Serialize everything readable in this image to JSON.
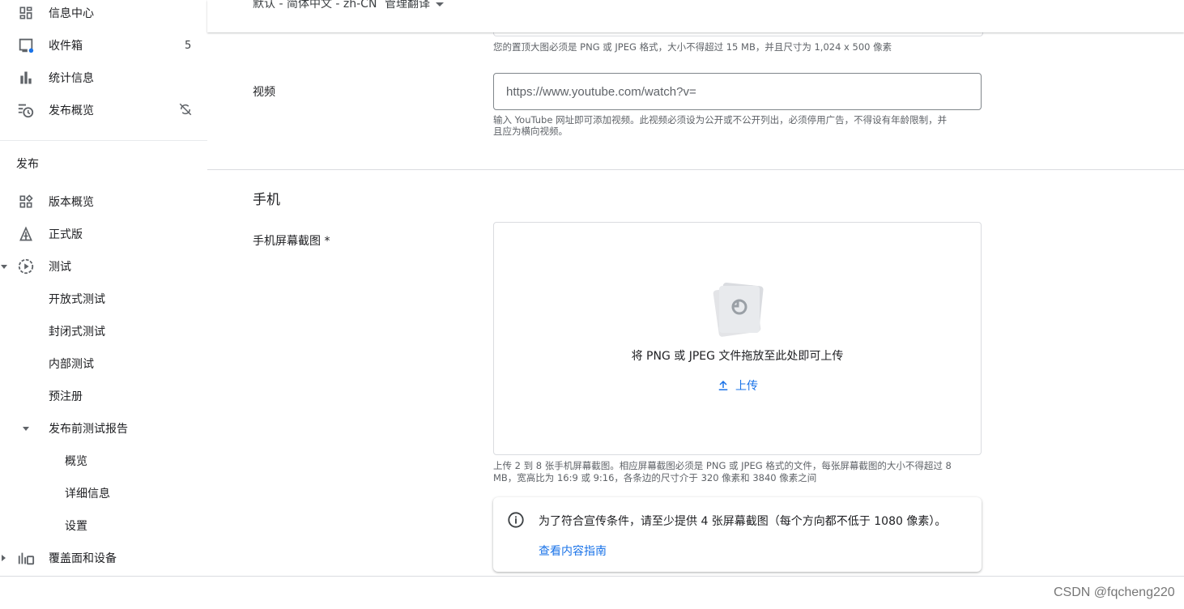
{
  "sidebar": {
    "items": [
      {
        "label": "信息中心",
        "icon": "dashboard-icon"
      },
      {
        "label": "收件箱",
        "icon": "inbox-icon",
        "badge": "5"
      },
      {
        "label": "统计信息",
        "icon": "bar-chart-icon"
      },
      {
        "label": "发布概览",
        "icon": "publishing-overview-icon",
        "trailing_icon": "managed-publishing-off-icon"
      }
    ],
    "section_label": "发布",
    "release_items": [
      {
        "label": "版本概览",
        "icon": "release-overview-icon"
      },
      {
        "label": "正式版",
        "icon": "production-icon"
      },
      {
        "label": "测试",
        "icon": "testing-icon",
        "expanded": true
      },
      {
        "label": "开放式测试"
      },
      {
        "label": "封闭式测试"
      },
      {
        "label": "内部测试"
      },
      {
        "label": "预注册"
      },
      {
        "label": "发布前测试报告",
        "expanded": true
      },
      {
        "label": "概览"
      },
      {
        "label": "详细信息"
      },
      {
        "label": "设置"
      },
      {
        "label": "覆盖面和设备",
        "icon": "reach-devices-icon",
        "expanded": false
      }
    ]
  },
  "topbar": {
    "language": "默认 - 简体中文 - zh-CN",
    "manage_translations": "管理翻译"
  },
  "main": {
    "feature_graphic_helper": "您的置顶大图必须是 PNG 或 JPEG 格式，大小不得超过 15 MB，并且尺寸为 1,024 x 500 像素",
    "video": {
      "label": "视频",
      "placeholder": "https://www.youtube.com/watch?v=",
      "helper_line1": "输入 YouTube 网址即可添加视频。此视频必须设为公开或不公开列出，必须停用广告，不得设有年龄限制，并",
      "helper_line2": "且应为横向视频。"
    },
    "phone_section": {
      "title": "手机",
      "screenshots_label": "手机屏幕截图 *",
      "dropzone_text": "将 PNG 或 JPEG 文件拖放至此处即可上传",
      "upload_label": "上传",
      "helper_line1": "上传 2 到 8 张手机屏幕截图。相应屏幕截图必须是 PNG 或 JPEG 格式的文件，每张屏幕截图的大小不得超过 8",
      "helper_line2": "MB，宽高比为 16:9 或 9:16，各条边的尺寸介于 320 像素和 3840 像素之间",
      "info_text": "为了符合宣传条件，请至少提供 4 张屏幕截图（每个方向都不低于 1080 像素）。",
      "info_link": "查看内容指南"
    }
  },
  "watermark": "CSDN @fqcheng220",
  "colors": {
    "accent": "#1a73e8",
    "text": "#202124",
    "secondary_text": "#5f6368",
    "border": "#dadce0",
    "badge_dot": "#1a73e8"
  }
}
